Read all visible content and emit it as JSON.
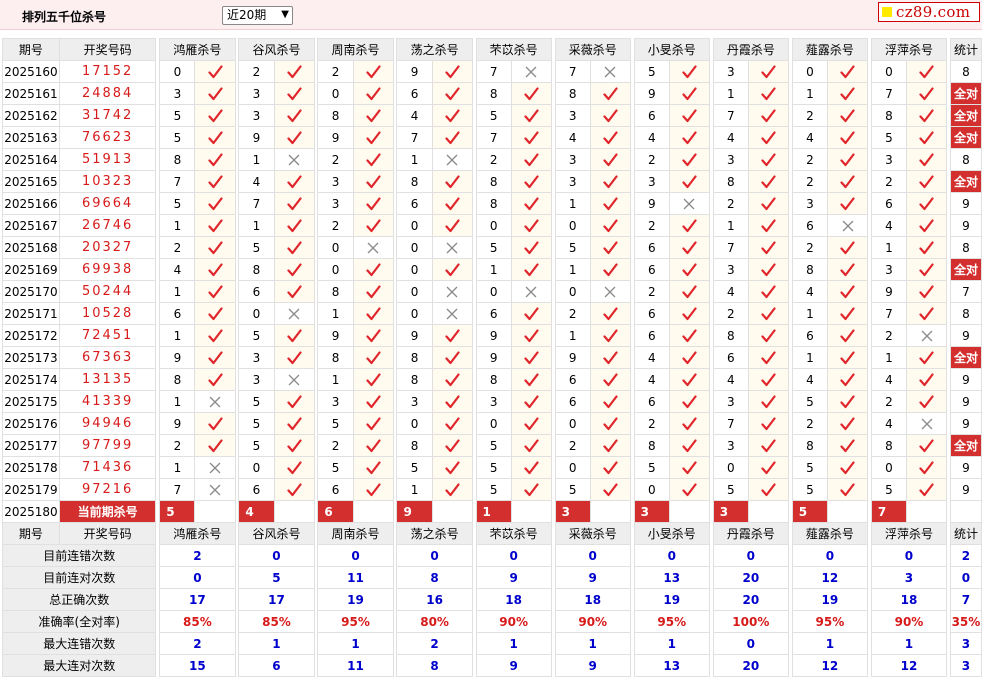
{
  "header": {
    "title": "排列五千位杀号",
    "period_select": "近20期",
    "logo": "cz89.com"
  },
  "table": {
    "col_issue": "期号",
    "col_draw": "开奖号码",
    "col_stat": "统计",
    "experts": [
      "鸿雁杀号",
      "谷风杀号",
      "周南杀号",
      "荡之杀号",
      "芣苡杀号",
      "采薇杀号",
      "小旻杀号",
      "丹霞杀号",
      "薤露杀号",
      "浮萍杀号"
    ],
    "rows": [
      {
        "issue": "2025160",
        "draw": "17152",
        "kill": [
          "0",
          "2",
          "2",
          "9",
          "7",
          "7",
          "5",
          "3",
          "0",
          "0"
        ],
        "hit": [
          1,
          1,
          1,
          1,
          0,
          0,
          1,
          1,
          1,
          1
        ],
        "stat": "8"
      },
      {
        "issue": "2025161",
        "draw": "24884",
        "kill": [
          "3",
          "3",
          "0",
          "6",
          "8",
          "8",
          "9",
          "1",
          "1",
          "7"
        ],
        "hit": [
          1,
          1,
          1,
          1,
          1,
          1,
          1,
          1,
          1,
          1
        ],
        "stat": "全对"
      },
      {
        "issue": "2025162",
        "draw": "31742",
        "kill": [
          "5",
          "3",
          "8",
          "4",
          "5",
          "3",
          "6",
          "7",
          "2",
          "8"
        ],
        "hit": [
          1,
          1,
          1,
          1,
          1,
          1,
          1,
          1,
          1,
          1
        ],
        "stat": "全对"
      },
      {
        "issue": "2025163",
        "draw": "76623",
        "kill": [
          "5",
          "9",
          "9",
          "7",
          "7",
          "4",
          "4",
          "4",
          "4",
          "5"
        ],
        "hit": [
          1,
          1,
          1,
          1,
          1,
          1,
          1,
          1,
          1,
          1
        ],
        "stat": "全对"
      },
      {
        "issue": "2025164",
        "draw": "51913",
        "kill": [
          "8",
          "1",
          "2",
          "1",
          "2",
          "3",
          "2",
          "3",
          "2",
          "3"
        ],
        "hit": [
          1,
          0,
          1,
          0,
          1,
          1,
          1,
          1,
          1,
          1
        ],
        "stat": "8"
      },
      {
        "issue": "2025165",
        "draw": "10323",
        "kill": [
          "7",
          "4",
          "3",
          "8",
          "8",
          "3",
          "3",
          "8",
          "2",
          "2"
        ],
        "hit": [
          1,
          1,
          1,
          1,
          1,
          1,
          1,
          1,
          1,
          1
        ],
        "stat": "全对"
      },
      {
        "issue": "2025166",
        "draw": "69664",
        "kill": [
          "5",
          "7",
          "3",
          "6",
          "8",
          "1",
          "9",
          "2",
          "3",
          "6"
        ],
        "hit": [
          1,
          1,
          1,
          1,
          1,
          1,
          0,
          1,
          1,
          1
        ],
        "stat": "9"
      },
      {
        "issue": "2025167",
        "draw": "26746",
        "kill": [
          "1",
          "1",
          "2",
          "0",
          "0",
          "0",
          "2",
          "1",
          "6",
          "4"
        ],
        "hit": [
          1,
          1,
          1,
          1,
          1,
          1,
          1,
          1,
          0,
          1
        ],
        "stat": "9"
      },
      {
        "issue": "2025168",
        "draw": "20327",
        "kill": [
          "2",
          "5",
          "0",
          "0",
          "5",
          "5",
          "6",
          "7",
          "2",
          "1"
        ],
        "hit": [
          1,
          1,
          0,
          0,
          1,
          1,
          1,
          1,
          1,
          1
        ],
        "stat": "8"
      },
      {
        "issue": "2025169",
        "draw": "69938",
        "kill": [
          "4",
          "8",
          "0",
          "0",
          "1",
          "1",
          "6",
          "3",
          "8",
          "3"
        ],
        "hit": [
          1,
          1,
          1,
          1,
          1,
          1,
          1,
          1,
          1,
          1
        ],
        "stat": "全对"
      },
      {
        "issue": "2025170",
        "draw": "50244",
        "kill": [
          "1",
          "6",
          "8",
          "0",
          "0",
          "0",
          "2",
          "4",
          "4",
          "9"
        ],
        "hit": [
          1,
          1,
          1,
          0,
          0,
          0,
          1,
          1,
          1,
          1
        ],
        "stat": "7"
      },
      {
        "issue": "2025171",
        "draw": "10528",
        "kill": [
          "6",
          "0",
          "1",
          "0",
          "6",
          "2",
          "6",
          "2",
          "1",
          "7"
        ],
        "hit": [
          1,
          0,
          1,
          0,
          1,
          1,
          1,
          1,
          1,
          1
        ],
        "stat": "8"
      },
      {
        "issue": "2025172",
        "draw": "72451",
        "kill": [
          "1",
          "5",
          "9",
          "9",
          "9",
          "1",
          "6",
          "8",
          "6",
          "2"
        ],
        "hit": [
          1,
          1,
          1,
          1,
          1,
          1,
          1,
          1,
          1,
          0
        ],
        "stat": "9"
      },
      {
        "issue": "2025173",
        "draw": "67363",
        "kill": [
          "9",
          "3",
          "8",
          "8",
          "9",
          "9",
          "4",
          "6",
          "1",
          "1"
        ],
        "hit": [
          1,
          1,
          1,
          1,
          1,
          1,
          1,
          1,
          1,
          1
        ],
        "stat": "全对"
      },
      {
        "issue": "2025174",
        "draw": "13135",
        "kill": [
          "8",
          "3",
          "1",
          "8",
          "8",
          "6",
          "4",
          "4",
          "4",
          "4"
        ],
        "hit": [
          1,
          0,
          1,
          1,
          1,
          1,
          1,
          1,
          1,
          1
        ],
        "stat": "9"
      },
      {
        "issue": "2025175",
        "draw": "41339",
        "kill": [
          "1",
          "5",
          "3",
          "3",
          "3",
          "6",
          "6",
          "3",
          "5",
          "2"
        ],
        "hit": [
          0,
          1,
          1,
          1,
          1,
          1,
          1,
          1,
          1,
          1
        ],
        "stat": "9"
      },
      {
        "issue": "2025176",
        "draw": "94946",
        "kill": [
          "9",
          "5",
          "5",
          "0",
          "0",
          "0",
          "2",
          "7",
          "2",
          "4"
        ],
        "hit": [
          1,
          1,
          1,
          1,
          1,
          1,
          1,
          1,
          1,
          0
        ],
        "stat": "9"
      },
      {
        "issue": "2025177",
        "draw": "97799",
        "kill": [
          "2",
          "5",
          "2",
          "8",
          "5",
          "2",
          "8",
          "3",
          "8",
          "8"
        ],
        "hit": [
          1,
          1,
          1,
          1,
          1,
          1,
          1,
          1,
          1,
          1
        ],
        "stat": "全对"
      },
      {
        "issue": "2025178",
        "draw": "71436",
        "kill": [
          "1",
          "0",
          "5",
          "5",
          "5",
          "0",
          "5",
          "0",
          "5",
          "0"
        ],
        "hit": [
          0,
          1,
          1,
          1,
          1,
          1,
          1,
          1,
          1,
          1
        ],
        "stat": "9"
      },
      {
        "issue": "2025179",
        "draw": "97216",
        "kill": [
          "7",
          "6",
          "6",
          "1",
          "5",
          "5",
          "0",
          "5",
          "5",
          "5"
        ],
        "hit": [
          0,
          1,
          1,
          1,
          1,
          1,
          1,
          1,
          1,
          1
        ],
        "stat": "9"
      }
    ],
    "predict": {
      "issue": "2025180",
      "label": "当前期杀号",
      "kill": [
        "5",
        "4",
        "6",
        "9",
        "1",
        "3",
        "3",
        "3",
        "5",
        "7"
      ]
    },
    "stats": [
      {
        "label": "目前连错次数",
        "values": [
          "2",
          "0",
          "0",
          "0",
          "0",
          "0",
          "0",
          "0",
          "0",
          "0"
        ],
        "total": "2"
      },
      {
        "label": "目前连对次数",
        "values": [
          "0",
          "5",
          "11",
          "8",
          "9",
          "9",
          "13",
          "20",
          "12",
          "3"
        ],
        "total": "0"
      },
      {
        "label": "总正确次数",
        "values": [
          "17",
          "17",
          "19",
          "16",
          "18",
          "18",
          "19",
          "20",
          "19",
          "18"
        ],
        "total": "7"
      },
      {
        "label": "准确率(全对率)",
        "values": [
          "85%",
          "85%",
          "95%",
          "80%",
          "90%",
          "90%",
          "95%",
          "100%",
          "95%",
          "90%"
        ],
        "total": "35%"
      },
      {
        "label": "最大连错次数",
        "values": [
          "2",
          "1",
          "1",
          "2",
          "1",
          "1",
          "1",
          "0",
          "1",
          "1"
        ],
        "total": "3"
      },
      {
        "label": "最大连对次数",
        "values": [
          "15",
          "6",
          "11",
          "8",
          "9",
          "9",
          "13",
          "20",
          "12",
          "12"
        ],
        "total": "3"
      }
    ]
  },
  "colors": {
    "accent": "#d32f2f",
    "check": "#e0252b",
    "cross": "#8a8a8a",
    "stat_blue": "#0000cc"
  }
}
